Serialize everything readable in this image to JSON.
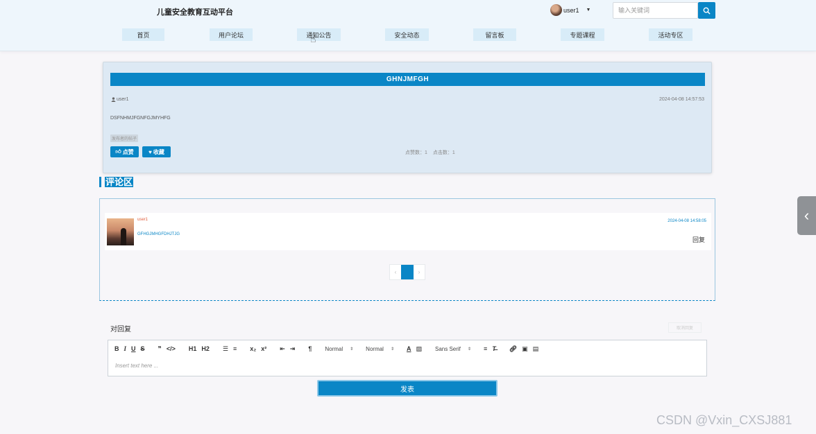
{
  "header": {
    "site_title": "儿童安全教育互动平台",
    "username": "user1",
    "search_placeholder": "输入关键词"
  },
  "nav": {
    "items": [
      {
        "label": "首页"
      },
      {
        "label": "用户论坛"
      },
      {
        "label": "通知公告"
      },
      {
        "label": "安全动态"
      },
      {
        "label": "留言板"
      },
      {
        "label": "专题课程"
      },
      {
        "label": "活动专区"
      }
    ]
  },
  "article": {
    "title": "GHNJMFGH",
    "author": "user1",
    "date": "2024-04-08 14:57:53",
    "content": "DSFNHMJFGNFGJMYHFG",
    "tag": "发布者的帖子",
    "like_label": "点赞",
    "favorite_label": "收藏",
    "like_count_label": "点赞数：1",
    "click_count_label": "点击数：1"
  },
  "comments": {
    "heading": "评论区",
    "items": [
      {
        "user": "user1",
        "text": "GFHGJMHGFDHJTJG",
        "date": "2024-04-08 14:58:05",
        "reply_label": "回复"
      }
    ],
    "pagination": {
      "prev": "‹",
      "next": "›"
    }
  },
  "reply": {
    "label": "对回复",
    "ghost_button": "取消回复",
    "toolbar": {
      "header1": "H1",
      "header2": "H2",
      "size_select": "Normal",
      "header_select": "Normal",
      "font_select": "Sans Serif"
    },
    "editor_placeholder": "Insert text here ...",
    "submit_label": "发表"
  },
  "watermark": "CSDN @Vxin_CXSJ881",
  "colors": {
    "accent": "#0a86c6",
    "header_bg": "#eef6fc",
    "card_bg": "#dde9f4",
    "page_bg": "#f7f6f9"
  }
}
